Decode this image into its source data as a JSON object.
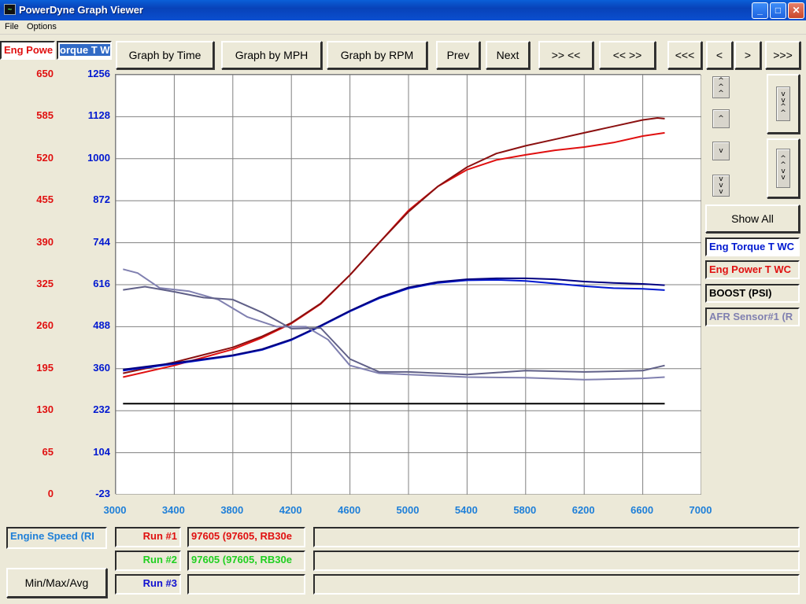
{
  "window": {
    "title": "PowerDyne Graph Viewer",
    "minimize": "_",
    "maximize": "□",
    "close": "✕"
  },
  "menu": {
    "file": "File",
    "options": "Options"
  },
  "toolbar": {
    "graph_time": "Graph by Time",
    "graph_mph": "Graph by MPH",
    "graph_rpm": "Graph by RPM",
    "prev": "Prev",
    "next": "Next",
    "zoom_in_x": ">> <<",
    "zoom_out_x": "<< >>",
    "scroll_far_left": "<<<",
    "scroll_left": "<",
    "scroll_right": ">",
    "scroll_far_right": ">>>"
  },
  "axis_selectors": {
    "left": "Eng Power",
    "right": "orque T W"
  },
  "right_panel": {
    "show_all": "Show All",
    "channels": [
      "Eng Torque T WC",
      "Eng Power T WC",
      "BOOST (PSI)",
      "AFR Sensor#1 (R"
    ]
  },
  "bottom": {
    "x_channel": "Engine Speed (RI",
    "minmax_button": "Min/Max/Avg",
    "runs": [
      {
        "label": "Run #1",
        "name": "97605 (97605, RB30e",
        "color": "#e01010"
      },
      {
        "label": "Run #2",
        "name": "97605 (97605, RB30e",
        "color": "#20d020"
      },
      {
        "label": "Run #3",
        "name": "",
        "color": "#1010d0"
      }
    ]
  },
  "colors": {
    "power": "#e01010",
    "torque": "#0018d0",
    "x_axis": "#1e7fd8",
    "boost": "#000000",
    "afr": "#8080b0"
  },
  "chart_data": {
    "type": "line",
    "xlabel": "Engine Speed (RI",
    "x_ticks": [
      3000,
      3400,
      3800,
      4200,
      4600,
      5000,
      5400,
      5800,
      6200,
      6600,
      7000
    ],
    "xlim": [
      3000,
      7000
    ],
    "y_left": {
      "label": "Eng Power",
      "ylim": [
        0,
        650
      ],
      "ticks": [
        650,
        585,
        520,
        455,
        390,
        325,
        260,
        195,
        130,
        65,
        0
      ]
    },
    "y_right": {
      "label": "orque T W",
      "ylim": [
        -23,
        1256
      ],
      "ticks": [
        1256,
        1128,
        1000,
        872,
        744,
        616,
        488,
        360,
        232,
        104,
        -23
      ]
    },
    "series": [
      {
        "name": "Eng Power T WC",
        "run": "Run #1",
        "axis": "left",
        "color": "#e01010",
        "x": [
          3050,
          3400,
          3800,
          4000,
          4200,
          4400,
          4600,
          4800,
          5000,
          5200,
          5400,
          5600,
          5800,
          6000,
          6200,
          6400,
          6600,
          6750
        ],
        "y": [
          182,
          200,
          225,
          243,
          265,
          295,
          340,
          390,
          440,
          477,
          503,
          518,
          526,
          533,
          538,
          545,
          555,
          560
        ]
      },
      {
        "name": "Eng Power T WC",
        "run": "Run #2",
        "axis": "left",
        "color": "#8b1010",
        "x": [
          3050,
          3400,
          3800,
          4000,
          4200,
          4400,
          4600,
          4800,
          5000,
          5200,
          5400,
          5600,
          5800,
          6000,
          6200,
          6400,
          6600,
          6700,
          6750
        ],
        "y": [
          188,
          205,
          228,
          245,
          266,
          296,
          340,
          390,
          438,
          477,
          507,
          528,
          540,
          550,
          560,
          570,
          580,
          583,
          582
        ]
      },
      {
        "name": "Eng Torque T WC",
        "run": "Run #1",
        "axis": "right",
        "color": "#0018d0",
        "x": [
          3050,
          3400,
          3800,
          4000,
          4200,
          4400,
          4600,
          4800,
          5000,
          5200,
          5400,
          5600,
          5800,
          6000,
          6200,
          6400,
          6600,
          6750
        ],
        "y": [
          355,
          375,
          400,
          418,
          448,
          490,
          535,
          575,
          605,
          622,
          630,
          631,
          628,
          620,
          612,
          606,
          604,
          600
        ]
      },
      {
        "name": "Eng Torque T WC",
        "run": "Run #2",
        "axis": "right",
        "color": "#000080",
        "x": [
          3050,
          3400,
          3800,
          4000,
          4200,
          4400,
          4600,
          4800,
          5000,
          5200,
          5400,
          5600,
          5800,
          6000,
          6200,
          6400,
          6600,
          6750
        ],
        "y": [
          358,
          378,
          402,
          420,
          450,
          492,
          537,
          578,
          608,
          625,
          633,
          636,
          636,
          633,
          626,
          622,
          619,
          615
        ]
      },
      {
        "name": "BOOST (PSI)",
        "run": "Run #1",
        "axis": "left",
        "color": "#000000",
        "x": [
          3050,
          6750
        ],
        "y": [
          141,
          141
        ]
      },
      {
        "name": "AFR Sensor#1 (R",
        "run": "Run #1",
        "axis": "left",
        "color": "#8080b0",
        "x": [
          3050,
          3150,
          3300,
          3500,
          3700,
          3900,
          4100,
          4300,
          4450,
          4600,
          4800,
          5000,
          5400,
          5800,
          6200,
          6600,
          6750
        ],
        "y": [
          349,
          343,
          320,
          315,
          302,
          275,
          260,
          260,
          240,
          200,
          188,
          186,
          182,
          181,
          178,
          180,
          182
        ]
      },
      {
        "name": "AFR Sensor#1 (R",
        "run": "Run #2",
        "axis": "left",
        "color": "#606088",
        "x": [
          3050,
          3200,
          3400,
          3600,
          3800,
          4000,
          4200,
          4400,
          4600,
          4800,
          5000,
          5400,
          5800,
          6200,
          6600,
          6750
        ],
        "y": [
          317,
          322,
          314,
          305,
          302,
          282,
          257,
          258,
          210,
          190,
          190,
          186,
          192,
          190,
          192,
          200
        ]
      }
    ]
  }
}
